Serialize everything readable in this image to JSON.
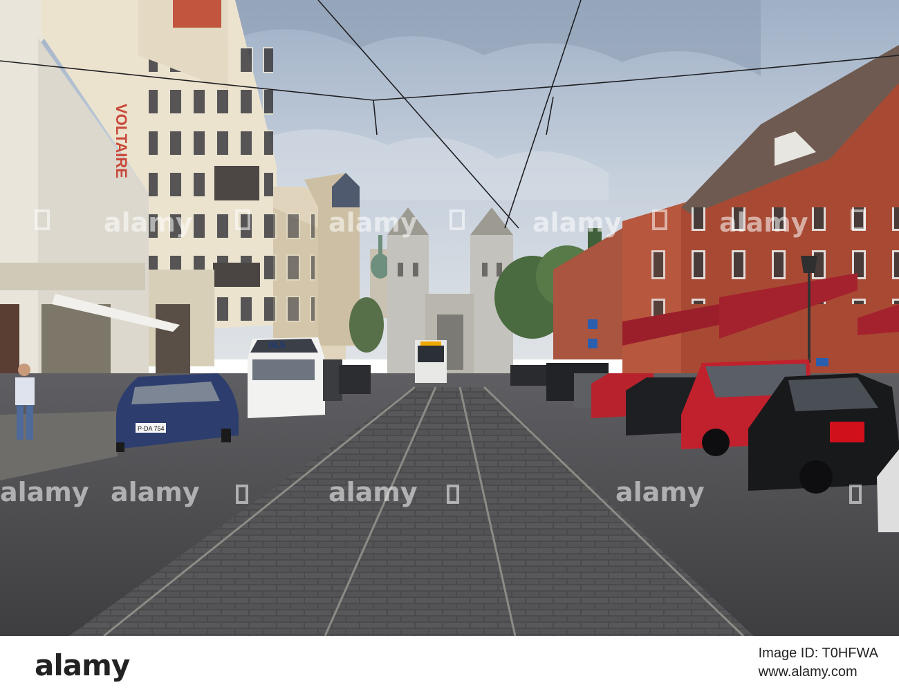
{
  "scene": {
    "shop_sign_text": "VOLTAIRE",
    "van_brand": "GLS",
    "plate_left_car": "P-DA 754"
  },
  "watermark": {
    "text": "alamy"
  },
  "footer": {
    "logo": "alamy",
    "image_id_label": "Image ID: T0HFWA",
    "site": "www.alamy.com"
  },
  "colors": {
    "sky": "#b9c6d6",
    "road": "#4b4a4c",
    "brick": "#b5553c",
    "awning": "#b0202c"
  }
}
